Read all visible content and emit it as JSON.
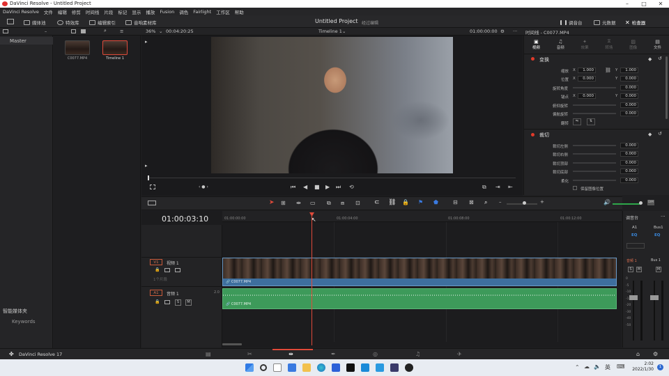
{
  "window": {
    "title": "DaVinci Resolve - Untitled Project"
  },
  "menu": [
    "DaVinci Resolve",
    "文件",
    "编辑",
    "修剪",
    "时间线",
    "片段",
    "标记",
    "显示",
    "播放",
    "Fusion",
    "调色",
    "Fairlight",
    "工作区",
    "帮助"
  ],
  "toolbar": {
    "media_pool": "媒体池",
    "effects": "特效库",
    "edit_index": "编辑索引",
    "sound_library": "音响素材库",
    "project_title": "Untitled Project",
    "project_status": "经过编辑",
    "mixer": "调音台",
    "metadata": "元数据",
    "inspector": "检查器"
  },
  "subbar": {
    "zoom": "36%",
    "duration": "00:04:20:25",
    "timeline_name": "Timeline 1",
    "timecode": "01:00:00:00",
    "inspector_title": "时间线 - C0077.MP4"
  },
  "bins": {
    "master": "Master",
    "smart_bins": "智能媒体夹",
    "keywords": "Keywords"
  },
  "clips": [
    {
      "name": "C0077.MP4"
    },
    {
      "name": "Timeline 1"
    }
  ],
  "inspector": {
    "tabs": [
      "视频",
      "音频",
      "效果",
      "转场",
      "图像",
      "文件"
    ],
    "transform_title": "变换",
    "zoom": {
      "label": "缩放",
      "x": "1.000",
      "y": "1.000"
    },
    "position": {
      "label": "位置",
      "x": "0.000",
      "y": "0.000"
    },
    "rotation": {
      "label": "旋转角度",
      "value": "0.000"
    },
    "anchor": {
      "label": "锚点",
      "x": "0.000",
      "y": "0.000"
    },
    "pitch": {
      "label": "俯仰旋转",
      "value": "0.000"
    },
    "yaw": {
      "label": "偏航旋转",
      "value": "0.000"
    },
    "flip": {
      "label": "翻转"
    },
    "crop_title": "裁切",
    "crop_left": {
      "label": "裁切左侧",
      "value": "0.000"
    },
    "crop_right": {
      "label": "裁切右侧",
      "value": "0.000"
    },
    "crop_top": {
      "label": "裁切顶部",
      "value": "0.000"
    },
    "crop_bottom": {
      "label": "裁切底部",
      "value": "0.000"
    },
    "softness": {
      "label": "柔化",
      "value": "0.000"
    },
    "keep_pos": "保留图像位置"
  },
  "timeline": {
    "current_tc": "01:00:03:10",
    "ruler": [
      "01:00:00:00",
      "01:00:04:00",
      "01:00:08:00",
      "01:00:12:00"
    ],
    "v1": {
      "tag": "V1",
      "name": "视频 1",
      "count": "1个片段",
      "clip": "C0077.MP4"
    },
    "a1": {
      "tag": "A1",
      "name": "音频 1",
      "level": "2.0",
      "clip": "C0077.MP4"
    }
  },
  "mixer": {
    "title": "调音台",
    "ch1": "A1",
    "ch2": "Bus1",
    "eq": "EQ",
    "audio1": "音频 1",
    "bus": "Bus 1",
    "db": [
      "0",
      "-5",
      "-10",
      "-15",
      "-20",
      "-30",
      "-40",
      "-50"
    ]
  },
  "app_label": "DaVinci Resolve 17",
  "taskbar": {
    "time": "2:02",
    "date": "2022/1/30",
    "lang": "英",
    "notif": "1"
  }
}
